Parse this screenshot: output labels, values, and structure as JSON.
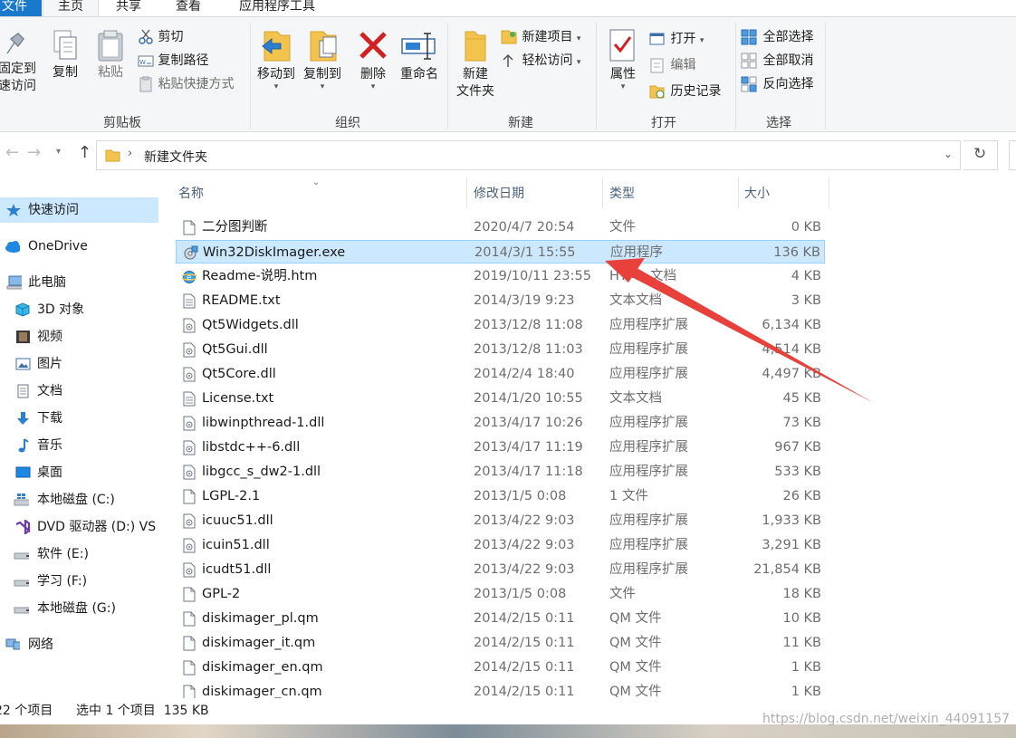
{
  "ribbon_tabs": [
    "文件",
    "主页",
    "共享",
    "查看",
    "应用程序工具"
  ],
  "clipboard": {
    "pin_line1": "固定到",
    "pin_line2": "速访问",
    "copy": "复制",
    "paste": "粘贴",
    "cut": "剪切",
    "copy_path": "复制路径",
    "paste_shortcut": "粘贴快捷方式",
    "label": "剪贴板"
  },
  "organize": {
    "move_to": "移动到",
    "copy_to": "复制到",
    "delete": "删除",
    "rename": "重命名",
    "label": "组织"
  },
  "new_group": {
    "new_folder_line1": "新建",
    "new_folder_line2": "文件夹",
    "new_item": "新建项目",
    "easy_access": "轻松访问",
    "label": "新建"
  },
  "open_group": {
    "properties": "属性",
    "open": "打开",
    "edit": "编辑",
    "history": "历史记录",
    "label": "打开"
  },
  "select_group": {
    "select_all": "全部选择",
    "select_none": "全部取消",
    "invert": "反向选择",
    "label": "选择"
  },
  "address": {
    "path": "新建文件夹"
  },
  "nav_items": [
    {
      "label": "快速访问",
      "icon": "star-icon"
    },
    {
      "label": "OneDrive",
      "icon": "cloud-icon"
    },
    {
      "label": "此电脑",
      "icon": "computer-icon"
    },
    {
      "label": "3D 对象",
      "icon": "cube-icon"
    },
    {
      "label": "视频",
      "icon": "film-icon"
    },
    {
      "label": "图片",
      "icon": "picture-icon"
    },
    {
      "label": "文档",
      "icon": "document-icon"
    },
    {
      "label": "下载",
      "icon": "download-icon"
    },
    {
      "label": "音乐",
      "icon": "music-icon"
    },
    {
      "label": "桌面",
      "icon": "desktop-icon"
    },
    {
      "label": "本地磁盘 (C:)",
      "icon": "windows-drive-icon"
    },
    {
      "label": "DVD 驱动器 (D:) VS",
      "icon": "visual-studio-icon"
    },
    {
      "label": "软件 (E:)",
      "icon": "drive-icon"
    },
    {
      "label": "学习 (F:)",
      "icon": "drive-icon"
    },
    {
      "label": "本地磁盘 (G:)",
      "icon": "drive-icon"
    },
    {
      "label": "网络",
      "icon": "network-icon"
    }
  ],
  "columns": [
    "名称",
    "修改日期",
    "类型",
    "大小"
  ],
  "files": [
    {
      "name": "二分图判断",
      "date": "2020/4/7 20:54",
      "type": "文件",
      "size": "0 KB",
      "icon": "file-icon"
    },
    {
      "name": "Win32DiskImager.exe",
      "date": "2014/3/1 15:55",
      "type": "应用程序",
      "size": "136 KB",
      "icon": "disk-imager-icon"
    },
    {
      "name": "Readme-说明.htm",
      "date": "2019/10/11 23:55",
      "type": "HTML 文档",
      "size": "4 KB",
      "icon": "ie-icon"
    },
    {
      "name": "README.txt",
      "date": "2014/3/19 9:23",
      "type": "文本文档",
      "size": "3 KB",
      "icon": "text-file-icon"
    },
    {
      "name": "Qt5Widgets.dll",
      "date": "2013/12/8 11:08",
      "type": "应用程序扩展",
      "size": "6,134 KB",
      "icon": "dll-icon"
    },
    {
      "name": "Qt5Gui.dll",
      "date": "2013/12/8 11:03",
      "type": "应用程序扩展",
      "size": "4,514 KB",
      "icon": "dll-icon"
    },
    {
      "name": "Qt5Core.dll",
      "date": "2014/2/4 18:40",
      "type": "应用程序扩展",
      "size": "4,497 KB",
      "icon": "dll-icon"
    },
    {
      "name": "License.txt",
      "date": "2014/1/20 10:55",
      "type": "文本文档",
      "size": "45 KB",
      "icon": "text-file-icon"
    },
    {
      "name": "libwinpthread-1.dll",
      "date": "2013/4/17 10:26",
      "type": "应用程序扩展",
      "size": "73 KB",
      "icon": "dll-icon"
    },
    {
      "name": "libstdc++-6.dll",
      "date": "2013/4/17 11:19",
      "type": "应用程序扩展",
      "size": "967 KB",
      "icon": "dll-icon"
    },
    {
      "name": "libgcc_s_dw2-1.dll",
      "date": "2013/4/17 11:18",
      "type": "应用程序扩展",
      "size": "533 KB",
      "icon": "dll-icon"
    },
    {
      "name": "LGPL-2.1",
      "date": "2013/1/5 0:08",
      "type": "1 文件",
      "size": "26 KB",
      "icon": "file-icon"
    },
    {
      "name": "icuuc51.dll",
      "date": "2013/4/22 9:03",
      "type": "应用程序扩展",
      "size": "1,933 KB",
      "icon": "dll-icon"
    },
    {
      "name": "icuin51.dll",
      "date": "2013/4/22 9:03",
      "type": "应用程序扩展",
      "size": "3,291 KB",
      "icon": "dll-icon"
    },
    {
      "name": "icudt51.dll",
      "date": "2013/4/22 9:03",
      "type": "应用程序扩展",
      "size": "21,854 KB",
      "icon": "dll-icon"
    },
    {
      "name": "GPL-2",
      "date": "2013/1/5 0:08",
      "type": "文件",
      "size": "18 KB",
      "icon": "file-icon"
    },
    {
      "name": "diskimager_pl.qm",
      "date": "2014/2/15 0:11",
      "type": "QM 文件",
      "size": "10 KB",
      "icon": "file-icon"
    },
    {
      "name": "diskimager_it.qm",
      "date": "2014/2/15 0:11",
      "type": "QM 文件",
      "size": "11 KB",
      "icon": "file-icon"
    },
    {
      "name": "diskimager_en.qm",
      "date": "2014/2/15 0:11",
      "type": "QM 文件",
      "size": "1 KB",
      "icon": "file-icon"
    },
    {
      "name": "diskimager_cn.qm",
      "date": "2014/2/15 0:11",
      "type": "QM 文件",
      "size": "1 KB",
      "icon": "file-icon"
    }
  ],
  "selected_file": "Win32DiskImager.exe",
  "status": {
    "item_count": "22 个项目",
    "selection": "选中 1 个项目  135 KB"
  },
  "watermark": "https://blog.csdn.net/weixin_44091157",
  "colors": {
    "accent": "#1979ca",
    "selection_bg": "#cce8ff",
    "selection_border": "#99d1ff",
    "annotation_arrow": "#e8403a"
  }
}
